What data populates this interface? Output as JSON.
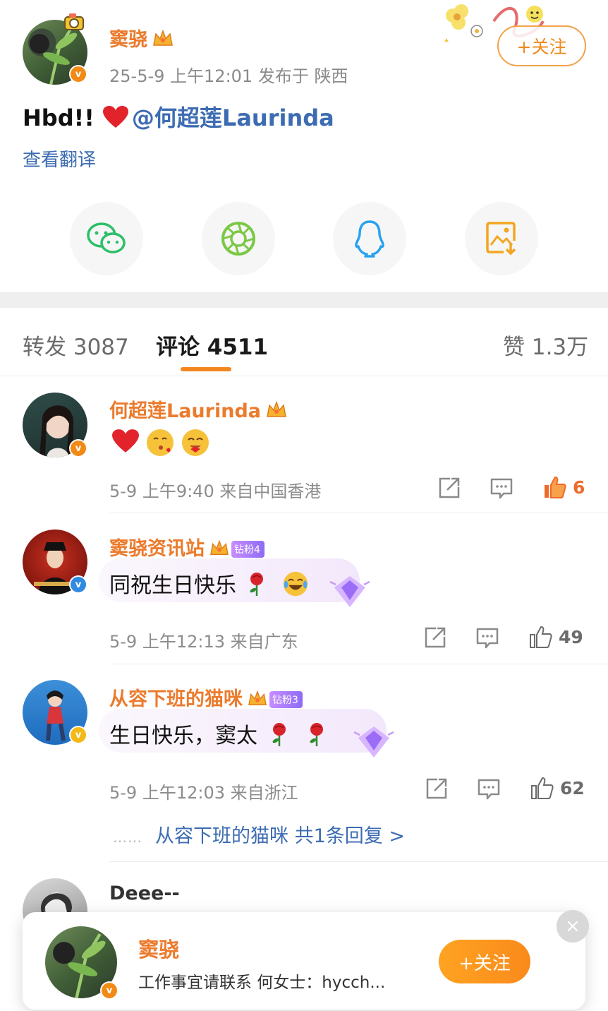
{
  "post": {
    "author": "窦骁",
    "time": "25-5-9 上午12:01 发布于 陕西",
    "follow_label": "+关注",
    "text": "Hbd!! ",
    "mention": "@何超莲Laurinda",
    "translate_label": "查看翻译"
  },
  "share": [
    "wechat-icon",
    "moments-icon",
    "qq-icon",
    "save-image-icon"
  ],
  "tabs": {
    "repost": "转发 3087",
    "comments": "评论 4511",
    "likes": "赞 1.3万"
  },
  "comments": [
    {
      "name": "何超莲Laurinda",
      "text": "",
      "meta": "5-9 上午9:40 来自中国香港",
      "likes": "6"
    },
    {
      "name": "窦骁资讯站",
      "fan_badge": "钻粉4",
      "text": "同祝生日快乐",
      "meta": "5-9 上午12:13 来自广东",
      "likes": "49"
    },
    {
      "name": "从容下班的猫咪",
      "fan_badge": "钻粉3",
      "text": "生日快乐，窦太",
      "meta": "5-9 上午12:03 来自浙江",
      "likes": "62",
      "reply_link": "从容下班的猫咪 共1条回复 >"
    },
    {
      "name": "Deee--"
    }
  ],
  "popup": {
    "name": "窦骁",
    "desc": "工作事宜请联系 何女士：hycch...",
    "follow_label": "+关注",
    "close": "×"
  },
  "colors": {
    "accent_orange": "#f4861f",
    "name_orange": "#eb7b2d",
    "link_blue": "#3d6cb2"
  }
}
